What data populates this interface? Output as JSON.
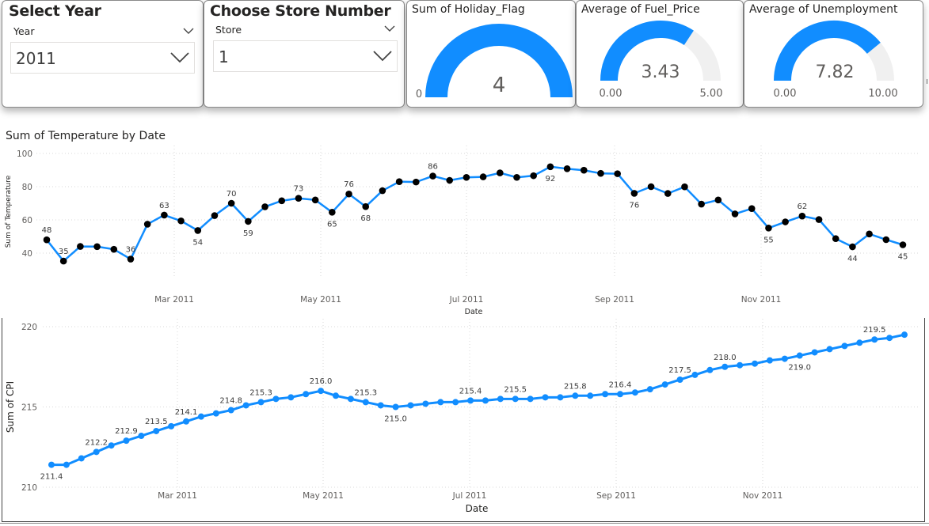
{
  "slicers": [
    {
      "title": "Select Year",
      "field": "Year",
      "value": "2011"
    },
    {
      "title": "Choose Store Number",
      "field": "Store",
      "value": "1"
    }
  ],
  "gauges": [
    {
      "title": "Sum of Holiday_Flag",
      "value": "4",
      "min": "0",
      "max": "",
      "fraction": 1.0
    },
    {
      "title": "Average of Fuel_Price",
      "value": "3.43",
      "min": "0.00",
      "max": "5.00",
      "fraction": 0.686
    },
    {
      "title": "Average of Unemployment",
      "value": "7.82",
      "min": "0.00",
      "max": "10.00",
      "fraction": 0.782
    }
  ],
  "colors": {
    "accent": "#118dff",
    "gauge_track": "#f0f0f0",
    "marker": "#000000"
  },
  "chart_data": [
    {
      "type": "line",
      "title": "Sum of Temperature by Date",
      "xlabel": "Date",
      "ylabel": "Sum of Temperature",
      "ylim": [
        30,
        100
      ],
      "yticks": [
        40,
        60,
        80,
        100
      ],
      "xticks": [
        "Mar 2011",
        "May 2011",
        "Jul 2011",
        "Sep 2011",
        "Nov 2011"
      ],
      "grid": true,
      "marker_color": "#000000",
      "series": [
        {
          "values": [
            48.0,
            35.2,
            44.0,
            43.9,
            42.3,
            36.4,
            57.4,
            62.9,
            59.4,
            53.6,
            62.6,
            70.0,
            59.1,
            67.9,
            71.5,
            73.0,
            72.0,
            64.6,
            75.6,
            68.0,
            77.6,
            83.0,
            82.8,
            86.4,
            83.8,
            85.6,
            85.9,
            88.3,
            85.6,
            86.6,
            92.0,
            90.8,
            89.9,
            88.0,
            87.8,
            76.0,
            80.0,
            75.9,
            79.9,
            69.5,
            72.0,
            63.6,
            66.8,
            55.1,
            58.8,
            62.3,
            60.2,
            48.7,
            43.8,
            51.5,
            48.1,
            45.0
          ]
        }
      ],
      "data_labels": [
        {
          "index": 0,
          "text": "48",
          "pos": "above"
        },
        {
          "index": 1,
          "text": "35",
          "pos": "above"
        },
        {
          "index": 5,
          "text": "36",
          "pos": "above"
        },
        {
          "index": 7,
          "text": "63",
          "pos": "above"
        },
        {
          "index": 9,
          "text": "54",
          "pos": "below"
        },
        {
          "index": 11,
          "text": "70",
          "pos": "above"
        },
        {
          "index": 12,
          "text": "59",
          "pos": "below"
        },
        {
          "index": 15,
          "text": "73",
          "pos": "above"
        },
        {
          "index": 17,
          "text": "65",
          "pos": "below"
        },
        {
          "index": 18,
          "text": "76",
          "pos": "above"
        },
        {
          "index": 19,
          "text": "68",
          "pos": "below"
        },
        {
          "index": 23,
          "text": "86",
          "pos": "above"
        },
        {
          "index": 30,
          "text": "92",
          "pos": "below"
        },
        {
          "index": 35,
          "text": "76",
          "pos": "below"
        },
        {
          "index": 43,
          "text": "55",
          "pos": "below"
        },
        {
          "index": 45,
          "text": "62",
          "pos": "above"
        },
        {
          "index": 48,
          "text": "44",
          "pos": "below"
        },
        {
          "index": 51,
          "text": "45",
          "pos": "below"
        }
      ]
    },
    {
      "type": "line",
      "title": "",
      "xlabel": "Date",
      "ylabel": "Sum of CPI",
      "ylim": [
        210,
        220
      ],
      "yticks": [
        210,
        215,
        220
      ],
      "xticks": [
        "Mar 2011",
        "May 2011",
        "Jul 2011",
        "Sep 2011",
        "Nov 2011"
      ],
      "grid": true,
      "series": [
        {
          "values": [
            211.4,
            211.4,
            211.8,
            212.2,
            212.6,
            212.9,
            213.2,
            213.5,
            213.8,
            214.1,
            214.4,
            214.6,
            214.8,
            215.1,
            215.3,
            215.5,
            215.6,
            215.8,
            216.0,
            215.7,
            215.5,
            215.3,
            215.1,
            215.0,
            215.1,
            215.2,
            215.3,
            215.3,
            215.4,
            215.4,
            215.5,
            215.5,
            215.5,
            215.6,
            215.6,
            215.7,
            215.7,
            215.8,
            215.8,
            215.9,
            216.1,
            216.4,
            216.7,
            217.0,
            217.3,
            217.5,
            217.6,
            217.7,
            217.9,
            218.0,
            218.2,
            218.4,
            218.6,
            218.8,
            219.0,
            219.2,
            219.3,
            219.5
          ]
        }
      ],
      "data_labels": [
        {
          "index": 0,
          "text": "211.4",
          "pos": "below"
        },
        {
          "index": 3,
          "text": "212.2",
          "pos": "above"
        },
        {
          "index": 5,
          "text": "212.9",
          "pos": "above"
        },
        {
          "index": 7,
          "text": "213.5",
          "pos": "above"
        },
        {
          "index": 9,
          "text": "214.1",
          "pos": "above"
        },
        {
          "index": 12,
          "text": "214.8",
          "pos": "above"
        },
        {
          "index": 14,
          "text": "215.3",
          "pos": "above"
        },
        {
          "index": 18,
          "text": "216.0",
          "pos": "above"
        },
        {
          "index": 21,
          "text": "215.3",
          "pos": "above"
        },
        {
          "index": 23,
          "text": "215.0",
          "pos": "below"
        },
        {
          "index": 28,
          "text": "215.4",
          "pos": "above"
        },
        {
          "index": 31,
          "text": "215.5",
          "pos": "above"
        },
        {
          "index": 35,
          "text": "215.8",
          "pos": "above"
        },
        {
          "index": 38,
          "text": "216.4",
          "pos": "above"
        },
        {
          "index": 42,
          "text": "217.5",
          "pos": "above"
        },
        {
          "index": 45,
          "text": "218.0",
          "pos": "above"
        },
        {
          "index": 50,
          "text": "219.0",
          "pos": "below"
        },
        {
          "index": 55,
          "text": "219.5",
          "pos": "above"
        }
      ]
    }
  ]
}
